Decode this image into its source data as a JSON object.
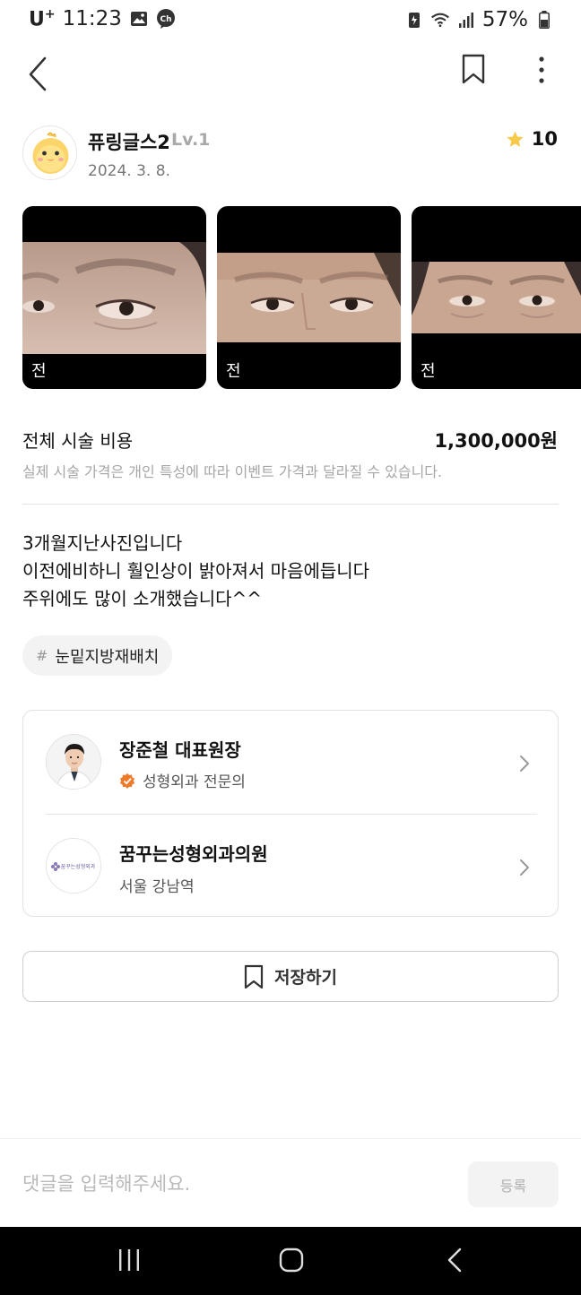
{
  "status_bar": {
    "carrier": "U",
    "carrier_sup": "+",
    "time": "11:23",
    "battery": "57%"
  },
  "author": {
    "name": "퓨링글스2",
    "level": "Lv.1",
    "date": "2024. 3. 8.",
    "rating": "10"
  },
  "photos": [
    {
      "label": "전"
    },
    {
      "label": "전"
    },
    {
      "label": "전"
    }
  ],
  "cost": {
    "label": "전체 시술 비용",
    "value": "1,300,000원",
    "note": "실제 시술 가격은 개인 특성에 따라 이벤트 가격과 달라질 수 있습니다."
  },
  "review": {
    "lines": [
      "3개월지난사진입니다",
      "이전에비하니 훨인상이 밝아져서 마음에듭니다",
      "주위에도 많이 소개했습니다^^"
    ]
  },
  "tag": {
    "hash": "#",
    "text": "눈밑지방재배치"
  },
  "doctor": {
    "name": "장준철 대표원장",
    "specialty": "성형외과 전문의",
    "badge_color": "#f07a2b"
  },
  "clinic": {
    "name": "꿈꾸는성형외과의원",
    "location": "서울 강남역",
    "logo_text": "꿈꾸는성형외과"
  },
  "save": {
    "label": "저장하기"
  },
  "comment": {
    "placeholder": "댓글을 입력해주세요.",
    "submit_label": "등록"
  },
  "colors": {
    "star": "#f7c948",
    "accent_badge": "#f07a2b"
  }
}
